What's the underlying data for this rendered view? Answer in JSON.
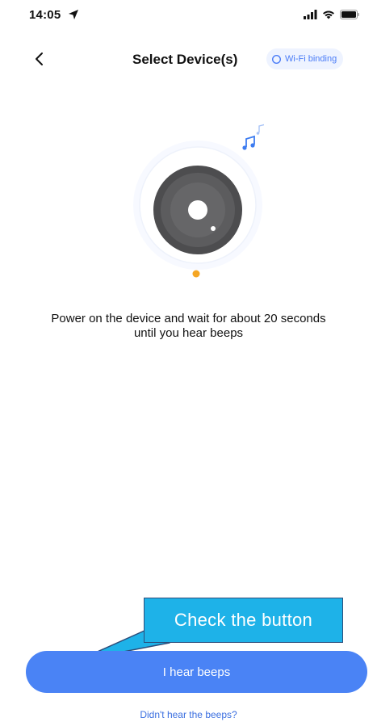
{
  "status_bar": {
    "time": "14:05",
    "location_icon": "location-arrow-icon",
    "signal_icon": "cellular-signal-icon",
    "wifi_icon": "wifi-icon",
    "battery_icon": "battery-icon"
  },
  "nav": {
    "back_icon": "chevron-left-icon",
    "title": "Select Device(s)",
    "wifi_binding_label": "Wi-Fi binding",
    "wifi_binding_icon": "refresh-circle-icon"
  },
  "illustration": {
    "device_icon": "speaker-disc-icon",
    "music_icon": "music-notes-icon",
    "indicator_color": "#f5a623"
  },
  "instruction": {
    "line1": "Power on the device and wait for about 20 seconds",
    "line2": "until you hear beeps"
  },
  "callout": {
    "label": "Check the button"
  },
  "actions": {
    "primary_label": "I hear beeps",
    "help_link": "Didn't hear the beeps?"
  },
  "colors": {
    "primary": "#4a83f5",
    "link": "#3b6fe0",
    "callout_fill": "#1eb2e8",
    "callout_border": "#2c4d7a",
    "indicator": "#f5a623"
  }
}
